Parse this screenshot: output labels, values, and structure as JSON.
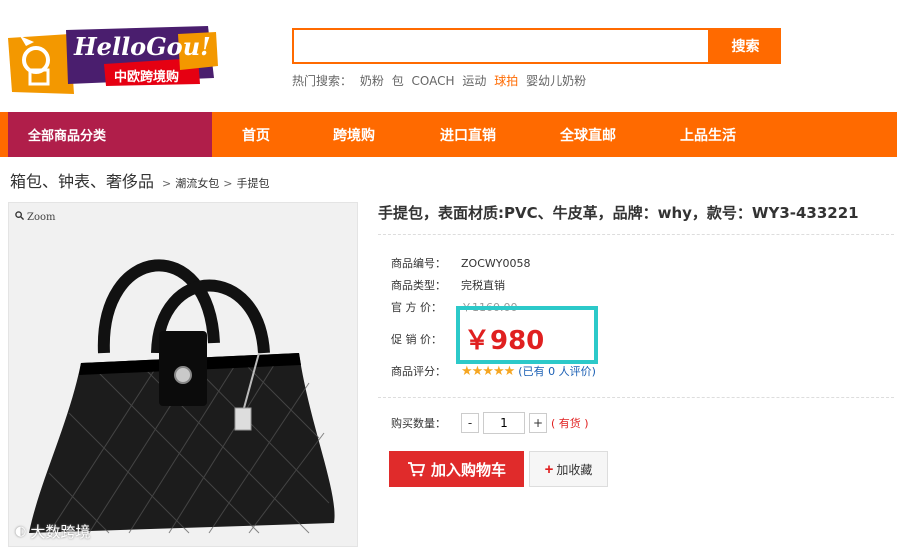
{
  "logo": {
    "text": "HelloGou!",
    "subtitle": "中欧跨境购"
  },
  "search": {
    "value": "",
    "button": "搜索"
  },
  "hot_searches": {
    "label": "热门搜索：",
    "items": [
      "奶粉",
      "包",
      "COACH",
      "运动",
      "球拍",
      "婴幼儿奶粉"
    ]
  },
  "nav": {
    "category": "全部商品分类",
    "items": [
      "首页",
      "跨境购",
      "进口直销",
      "全球直邮",
      "上品生活"
    ]
  },
  "breadcrumb": {
    "level1": "箱包、钟表、奢侈品",
    "sep1": ">",
    "level2": "潮流女包",
    "sep2": ">",
    "level3": "手提包"
  },
  "image": {
    "zoom": "Zoom",
    "watermark": "大数跨境"
  },
  "product": {
    "title": "手提包，表面材质:PVC、牛皮革，品牌：why，款号：WY3-433221",
    "code_label": "商品编号：",
    "code": "ZOCWY0058",
    "type_label": "商品类型：",
    "type": "完税直销",
    "official_label": "官 方 价：",
    "official_price": "￥1160.00",
    "promo_label": "促 销 价：",
    "promo_price": "￥980",
    "rating_label": "商品评分：",
    "rating": 5,
    "review_text": "(已有 0 人评价)",
    "qty_label": "购买数量：",
    "qty": "1",
    "minus": "-",
    "plus": "+",
    "stock": "( 有货 )",
    "add_cart": "加入购物车",
    "favorite": "加收藏"
  },
  "colors": {
    "accent": "#ff6a00",
    "category": "#b01e4a",
    "price": "#e02020",
    "highlight_box": "#2cc9c9"
  }
}
